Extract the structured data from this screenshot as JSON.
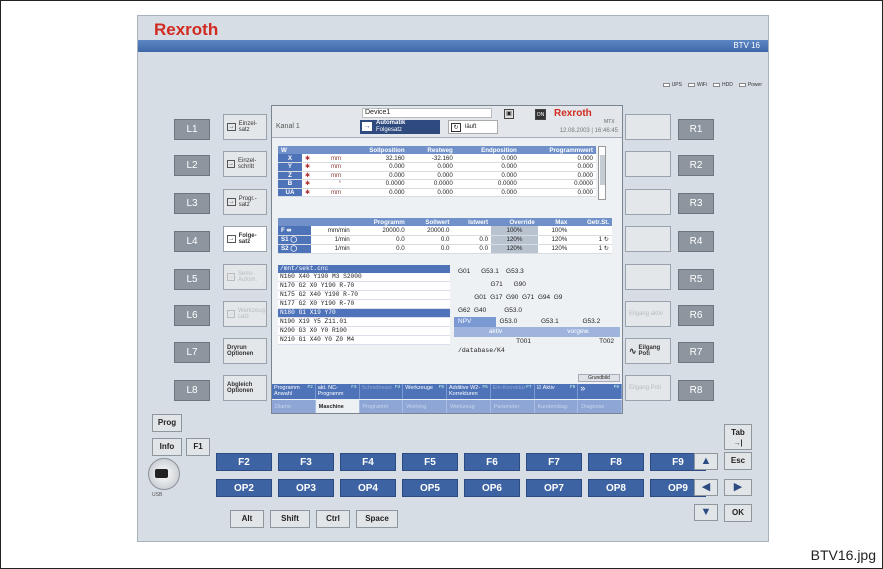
{
  "brand": "Rexroth",
  "model": "BTV 16",
  "leds": [
    "UPS",
    "WiFi",
    "HDD",
    "Power"
  ],
  "left_keys": [
    "L1",
    "L2",
    "L3",
    "L4",
    "L5",
    "L6",
    "L7",
    "L8"
  ],
  "right_keys": [
    "R1",
    "R2",
    "R3",
    "R4",
    "R5",
    "R6",
    "R7",
    "R8"
  ],
  "left_softkeys": [
    {
      "label": "Einzel-satz",
      "icon": "arrow-right-icon",
      "dim": false
    },
    {
      "label": "Einzel-schritt",
      "icon": "arrow-right-icon",
      "dim": false
    },
    {
      "label": "Progr.-satz",
      "icon": "arrow-right-icon",
      "dim": false
    },
    {
      "label": "Folge-satz",
      "icon": "arrow-right-icon",
      "dim": false
    },
    {
      "label": "Semi-Autom.",
      "icon": "arrow-right-icon",
      "dim": true
    },
    {
      "label": "Werkzeug-satz",
      "icon": "arrow-right-icon",
      "dim": true
    },
    {
      "label": "Dryrun Optionen",
      "icon": "",
      "dim": false
    },
    {
      "label": "Abgleich Optionen",
      "icon": "",
      "dim": false
    }
  ],
  "right_softkeys": [
    {
      "label": "",
      "dim": true
    },
    {
      "label": "",
      "dim": true
    },
    {
      "label": "",
      "dim": true
    },
    {
      "label": "",
      "dim": true
    },
    {
      "label": "",
      "dim": true
    },
    {
      "label": "Eilgang aktiv",
      "dim": true
    },
    {
      "label": "Eilgang Poti",
      "dim": false
    },
    {
      "label": "Eilgang Poti",
      "dim": true
    }
  ],
  "screen": {
    "device": "Device1",
    "channel": "Kanal 1",
    "mode": "Automatik",
    "submode": "Folgesatz",
    "run_state": "läuft",
    "logo": "Rexroth",
    "logo_sub": "MTX",
    "timestamp": "12.08.2003 | 16:46:45",
    "axis_headers": [
      "W",
      "",
      "",
      "Sollposition",
      "Restweg",
      "Endposition",
      "Programmwert"
    ],
    "axes": [
      {
        "name": "X",
        "unit": "mm",
        "soll": "32.160",
        "rest": "-32.160",
        "end": "0.000",
        "prog": "0.000"
      },
      {
        "name": "Y",
        "unit": "mm",
        "soll": "0.000",
        "rest": "0.000",
        "end": "0.000",
        "prog": "0.000"
      },
      {
        "name": "Z",
        "unit": "mm",
        "soll": "0.000",
        "rest": "0.000",
        "end": "0.000",
        "prog": "0.000"
      },
      {
        "name": "B",
        "unit": "°",
        "soll": "0.0000",
        "rest": "0.0000",
        "end": "0.0000",
        "prog": "0.0000"
      },
      {
        "name": "UA",
        "unit": "mm",
        "soll": "0.000",
        "rest": "0.000",
        "end": "0.000",
        "prog": "0.000"
      }
    ],
    "spindle_headers": [
      "",
      "",
      "Programm",
      "Sollwert",
      "Istwert",
      "Override",
      "Max",
      "Getr.St."
    ],
    "spindles": [
      {
        "name": "F",
        "unit": "mm/min",
        "prog": "20000.0",
        "soll": "20000.0",
        "ist": "",
        "ov": "100%",
        "max": "100%",
        "gear": ""
      },
      {
        "name": "S1",
        "unit": "1/min",
        "prog": "0.0",
        "soll": "0.0",
        "ist": "0.0",
        "ov": "120%",
        "max": "120%",
        "gear": "1"
      },
      {
        "name": "S2",
        "unit": "1/min",
        "prog": "0.0",
        "soll": "0.0",
        "ist": "0.0",
        "ov": "120%",
        "max": "120%",
        "gear": "1"
      }
    ],
    "program_path": "/mnt/sekt.cnc",
    "program_lines": [
      "N160 X40 Y190 M3 S2000",
      "N170 G2 X0 Y190 R-70",
      "N175 G2 X40 Y190 R-70",
      "N177 G2 X0 Y190 R-70",
      "N180 G1 X19 Y70",
      "N190 X19 Y5 Z11.01",
      "N200 G3 X0 Y0 R100",
      "N210 G1 X40 Y0 Z0 M4"
    ],
    "selected_line": 4,
    "gcode_row1": "G01      G53.1    G53.3",
    "gcode_row2": "                  G71      G90",
    "gcode_row3": "         G01  G17  G90  G71  G94  G9",
    "gcode_row4": "G62  G40          G53.0",
    "npv_label": "NPV",
    "npv_values": [
      "G53.0",
      "G53.1",
      "G53.2"
    ],
    "tool_headers": [
      "aktiv",
      "vorgew."
    ],
    "tools": [
      "T001",
      "T002"
    ],
    "database": "/database/K4",
    "grundbild": "Grundbild",
    "fbar_top": [
      {
        "label": "Programm Anwahl",
        "num": "F2",
        "dim": false
      },
      {
        "label": "akt. NC-Programm",
        "num": "F3",
        "dim": false
      },
      {
        "label": "Schnellreset",
        "num": "F4",
        "dim": true
      },
      {
        "label": "Werkzeuge",
        "num": "F5",
        "dim": false
      },
      {
        "label": "Additive W2-Korrekturen",
        "num": "F6",
        "dim": false
      },
      {
        "label": "Ein-Korrektur",
        "num": "F7",
        "dim": true
      },
      {
        "label": "Aktiv",
        "num": "F8",
        "dim": false
      },
      {
        "label": "»",
        "num": "F9",
        "dim": false
      }
    ],
    "fbar_bottom": [
      {
        "label": "Diamo",
        "active": false
      },
      {
        "label": "Maschine",
        "active": true
      },
      {
        "label": "Programm",
        "active": false
      },
      {
        "label": "Working Management",
        "active": false
      },
      {
        "label": "Werkzeug",
        "active": false
      },
      {
        "label": "Parameter",
        "active": false
      },
      {
        "label": "Kundendiag.",
        "active": false
      },
      {
        "label": "Diagnose",
        "active": false
      }
    ]
  },
  "fkeys": [
    "F2",
    "F3",
    "F4",
    "F5",
    "F6",
    "F7",
    "F8",
    "F9"
  ],
  "opkeys": [
    "OP2",
    "OP3",
    "OP4",
    "OP5",
    "OP6",
    "OP7",
    "OP8",
    "OP9"
  ],
  "side_keys": {
    "prog": "Prog",
    "info": "Info",
    "f1": "F1",
    "tab": "Tab",
    "esc": "Esc",
    "ok": "OK"
  },
  "mod_keys": [
    "Alt",
    "Shift",
    "Ctrl",
    "Space"
  ],
  "usb_label": "USB",
  "caption": "BTV16.jpg"
}
